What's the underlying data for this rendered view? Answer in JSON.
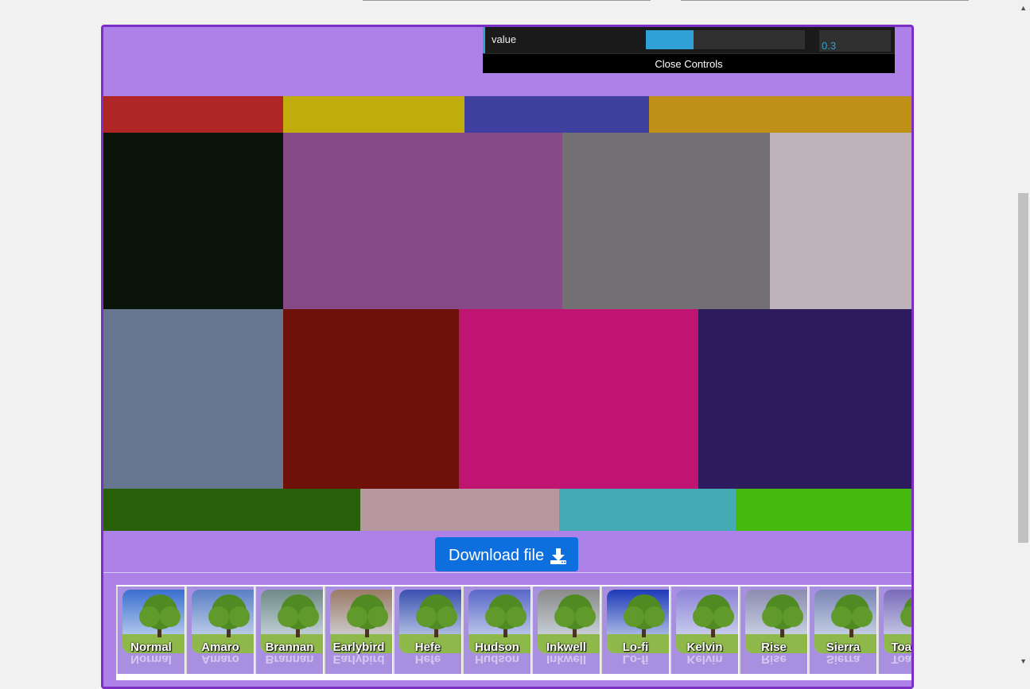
{
  "controls": {
    "label": "value",
    "slider_fraction": 0.3,
    "value_text": "0.3",
    "close_label": "Close Controls"
  },
  "download": {
    "label": "Download file",
    "icon": "download-icon"
  },
  "colors": {
    "panel_bg": "#ad81e8",
    "panel_border": "#7c2fc5",
    "gui_accent": "#2fa1d6",
    "button": "#0d6ede"
  },
  "filters": [
    {
      "name": "Normal",
      "tint": "#3a6fd0"
    },
    {
      "name": "Amaro",
      "tint": "#5b7fc4"
    },
    {
      "name": "Brannan",
      "tint": "#6f8a86"
    },
    {
      "name": "Earlybird",
      "tint": "#9a7a66"
    },
    {
      "name": "Hefe",
      "tint": "#3a50b0"
    },
    {
      "name": "Hudson",
      "tint": "#5a68c8"
    },
    {
      "name": "Inkwell",
      "tint": "#8a8a8a"
    },
    {
      "name": "Lo-fi",
      "tint": "#1e3ab8"
    },
    {
      "name": "Kelvin",
      "tint": "#8c82d8"
    },
    {
      "name": "Rise",
      "tint": "#8c8cb0"
    },
    {
      "name": "Sierra",
      "tint": "#7a86b4"
    },
    {
      "name": "Toaster",
      "tint": "#7a6ab8"
    }
  ]
}
